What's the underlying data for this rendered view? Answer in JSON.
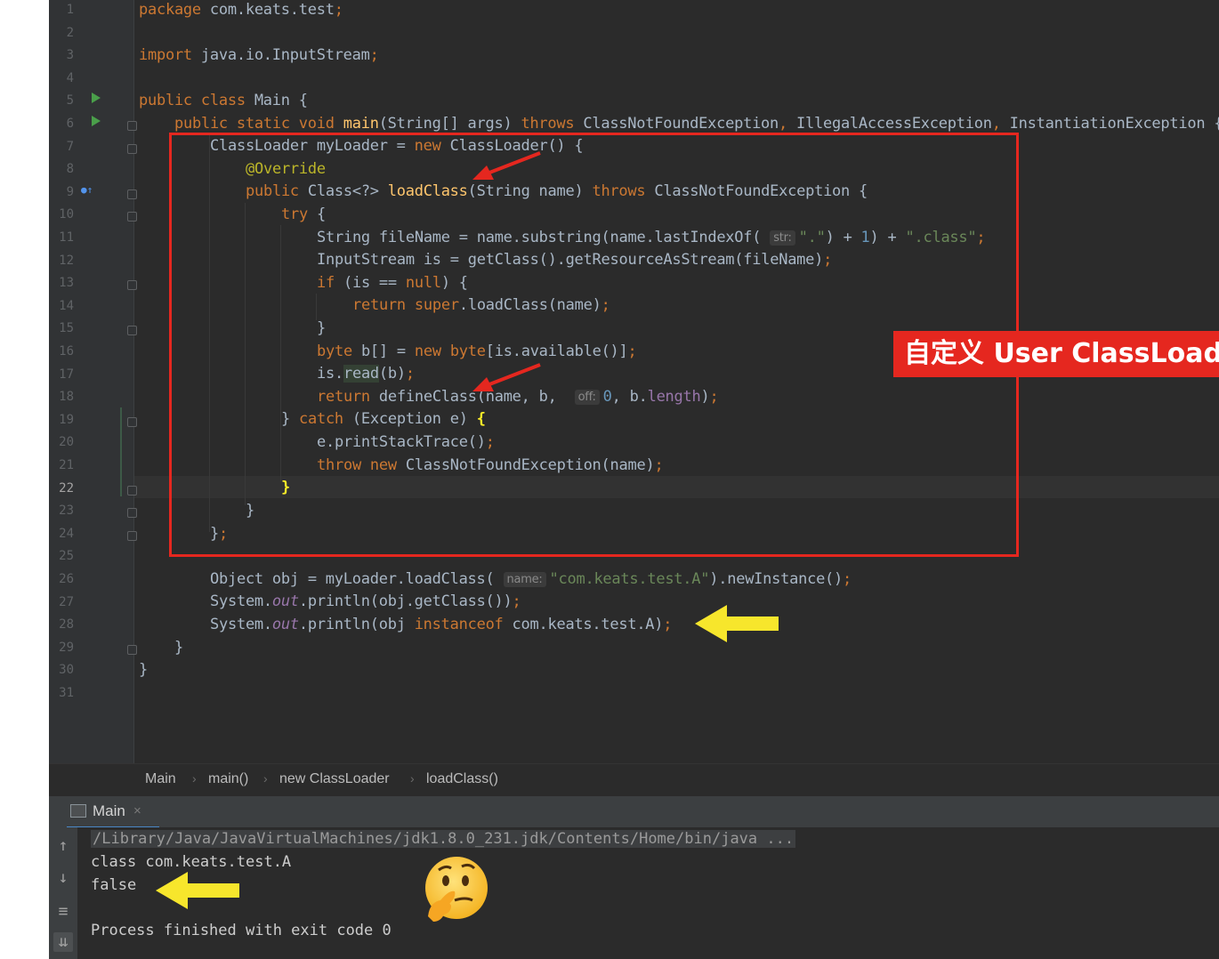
{
  "editor": {
    "line_numbers": [
      "1",
      "2",
      "3",
      "4",
      "5",
      "6",
      "7",
      "8",
      "9",
      "10",
      "11",
      "12",
      "13",
      "14",
      "15",
      "16",
      "17",
      "18",
      "19",
      "20",
      "21",
      "22",
      "23",
      "24",
      "25",
      "26",
      "27",
      "28",
      "29",
      "30",
      "31"
    ],
    "current_line": "22",
    "code": {
      "l1_kw": "package",
      "l1_rest": " com.keats.test",
      "l3_kw": "import",
      "l3_rest": " java.io.InputStream",
      "semi": ";",
      "l5_kw": "public class",
      "l5_rest": " Main {",
      "l6_kw": "public static void",
      "l6_fn": "main",
      "l6_args": "(String[] args) ",
      "l6_throws": "throws",
      "l6_exc1": " ClassNotFoundException",
      "l6_exc2": " IllegalAccessException",
      "l6_exc3": " InstantiationException {",
      "comma": ",",
      "l7_a": "ClassLoader myLoader = ",
      "l7_new": "new",
      "l7_b": " ClassLoader() {",
      "l8": "@Override",
      "l9_kw": "public",
      "l9_a": " Class<?> ",
      "l9_fn": "loadClass",
      "l9_b": "(String name) ",
      "l9_throws": "throws",
      "l9_c": " ClassNotFoundException {",
      "l10_kw": "try",
      "l10_b": " {",
      "l11_a": "String fileName = name.substring(name.lastIndexOf(",
      "l11_hint": "str:",
      "l11_str1": "\".\"",
      "l11_b": ") + ",
      "l11_num": "1",
      "l11_c": ") + ",
      "l11_str2": "\".class\"",
      "l12_a": "InputStream is = getClass().getResourceAsStream(fileName)",
      "l13_kw": "if",
      "l13_a": " (is == ",
      "l13_null": "null",
      "l13_b": ") {",
      "l14_ret": "return",
      "l14_super": " super",
      "l14_a": ".loadClass(name)",
      "rbrace": "}",
      "l16_kw": "byte",
      "l16_a": " b[] = ",
      "l16_new": "new",
      "l16_byte": " byte",
      "l16_b": "[is.available()]",
      "l17_a": "is.",
      "l17_read": "read",
      "l17_b": "(b)",
      "l18_ret": "return",
      "l18_a": " defineClass(name, b, ",
      "l18_hint": "off:",
      "l18_num": "0",
      "l18_b": ", b.",
      "l18_len": "length",
      "l18_c": ")",
      "l19_a": "} ",
      "l19_catch": "catch",
      "l19_b": " (Exception e) ",
      "lbrace": "{",
      "l20_a": "e.printStackTrace()",
      "l21_throw": "throw",
      "l21_new": " new",
      "l21_a": " ClassNotFoundException(name)",
      "l24_a": "}",
      "l26_a": "Object obj = myLoader.loadClass(",
      "l26_hint": "name:",
      "l26_str": "\"com.keats.test.A\"",
      "l26_b": ").newInstance()",
      "l27_a": "System.",
      "l27_out": "out",
      "l27_b": ".println(obj.getClass())",
      "l28_a": "System.",
      "l28_out": "out",
      "l28_b": ".println(obj ",
      "l28_kw": "instanceof",
      "l28_c": " com.keats.test.A)"
    }
  },
  "breadcrumb": [
    "Main",
    "main()",
    "new ClassLoader",
    "loadClass()"
  ],
  "breadcrumb_sep": "›",
  "run_panel": {
    "tab_label": "Main",
    "tab_close": "×",
    "java_cmd": "/Library/Java/JavaVirtualMachines/jdk1.8.0_231.jdk/Contents/Home/bin/java ...",
    "output_line1": "class com.keats.test.A",
    "output_line2": "false",
    "finished": "Process finished with exit code 0"
  },
  "annotation": {
    "label": "自定义 User ClassLoader",
    "box_color": "#e5271f",
    "arrow_red": "#e5271f",
    "arrow_yellow": "#f7e62c",
    "emoji": "🤔"
  },
  "icons": [
    "run-gutter-icon",
    "override-gutter-icon",
    "fold-icon",
    "console-icon",
    "close-icon",
    "up-icon",
    "down-icon",
    "soft-wrap-icon",
    "scroll-end-icon"
  ]
}
